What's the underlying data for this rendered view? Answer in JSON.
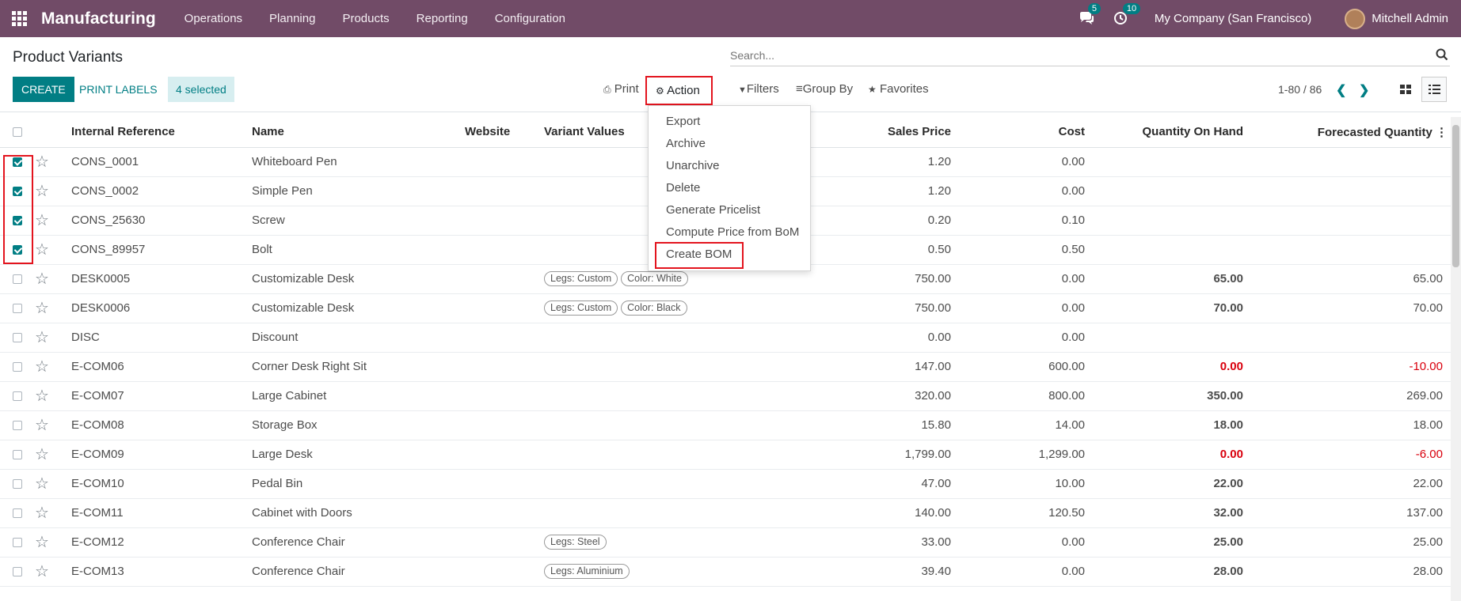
{
  "topbar": {
    "app_name": "Manufacturing",
    "menu": [
      "Operations",
      "Planning",
      "Products",
      "Reporting",
      "Configuration"
    ],
    "chat_count": "5",
    "activity_count": "10",
    "company": "My Company (San Francisco)",
    "user": "Mitchell Admin"
  },
  "control_panel": {
    "breadcrumb": "Product Variants",
    "search_placeholder": "Search...",
    "create_label": "CREATE",
    "print_labels_label": "PRINT LABELS",
    "selected_label": "4 selected",
    "print_label": "Print",
    "action_label": "Action",
    "filters_label": "Filters",
    "groupby_label": "Group By",
    "favorites_label": "Favorites",
    "pager": "1-80 / 86"
  },
  "action_menu": [
    "Export",
    "Archive",
    "Unarchive",
    "Delete",
    "Generate Pricelist",
    "Compute Price from BoM",
    "Create BOM"
  ],
  "columns": [
    "Internal Reference",
    "Name",
    "Website",
    "Variant Values",
    "Sales Price",
    "Cost",
    "Quantity On Hand",
    "Forecasted Quantity"
  ],
  "rows": [
    {
      "selected": true,
      "ref": "CONS_0001",
      "name": "Whiteboard Pen",
      "tags": [],
      "price": "1.20",
      "cost": "0.00",
      "qty": "",
      "forecast": ""
    },
    {
      "selected": true,
      "ref": "CONS_0002",
      "name": "Simple Pen",
      "tags": [],
      "price": "1.20",
      "cost": "0.00",
      "qty": "",
      "forecast": ""
    },
    {
      "selected": true,
      "ref": "CONS_25630",
      "name": "Screw",
      "tags": [],
      "price": "0.20",
      "cost": "0.10",
      "qty": "",
      "forecast": ""
    },
    {
      "selected": true,
      "ref": "CONS_89957",
      "name": "Bolt",
      "tags": [],
      "price": "0.50",
      "cost": "0.50",
      "qty": "",
      "forecast": ""
    },
    {
      "selected": false,
      "ref": "DESK0005",
      "name": "Customizable Desk",
      "tags": [
        "Legs: Custom",
        "Color: White"
      ],
      "price": "750.00",
      "cost": "0.00",
      "qty": "65.00",
      "forecast": "65.00"
    },
    {
      "selected": false,
      "ref": "DESK0006",
      "name": "Customizable Desk",
      "tags": [
        "Legs: Custom",
        "Color: Black"
      ],
      "price": "750.00",
      "cost": "0.00",
      "qty": "70.00",
      "forecast": "70.00"
    },
    {
      "selected": false,
      "ref": "DISC",
      "name": "Discount",
      "tags": [],
      "price": "0.00",
      "cost": "0.00",
      "qty": "",
      "forecast": ""
    },
    {
      "selected": false,
      "ref": "E-COM06",
      "name": "Corner Desk Right Sit",
      "tags": [],
      "price": "147.00",
      "cost": "600.00",
      "qty": "0.00",
      "forecast": "-10.00",
      "neg": true
    },
    {
      "selected": false,
      "ref": "E-COM07",
      "name": "Large Cabinet",
      "tags": [],
      "price": "320.00",
      "cost": "800.00",
      "qty": "350.00",
      "forecast": "269.00"
    },
    {
      "selected": false,
      "ref": "E-COM08",
      "name": "Storage Box",
      "tags": [],
      "price": "15.80",
      "cost": "14.00",
      "qty": "18.00",
      "forecast": "18.00"
    },
    {
      "selected": false,
      "ref": "E-COM09",
      "name": "Large Desk",
      "tags": [],
      "price": "1,799.00",
      "cost": "1,299.00",
      "qty": "0.00",
      "forecast": "-6.00",
      "neg": true
    },
    {
      "selected": false,
      "ref": "E-COM10",
      "name": "Pedal Bin",
      "tags": [],
      "price": "47.00",
      "cost": "10.00",
      "qty": "22.00",
      "forecast": "22.00"
    },
    {
      "selected": false,
      "ref": "E-COM11",
      "name": "Cabinet with Doors",
      "tags": [],
      "price": "140.00",
      "cost": "120.50",
      "qty": "32.00",
      "forecast": "137.00"
    },
    {
      "selected": false,
      "ref": "E-COM12",
      "name": "Conference Chair",
      "tags": [
        "Legs: Steel"
      ],
      "price": "33.00",
      "cost": "0.00",
      "qty": "25.00",
      "forecast": "25.00"
    },
    {
      "selected": false,
      "ref": "E-COM13",
      "name": "Conference Chair",
      "tags": [
        "Legs: Aluminium"
      ],
      "price": "39.40",
      "cost": "0.00",
      "qty": "28.00",
      "forecast": "28.00"
    }
  ],
  "colors": {
    "brand": "#714b67",
    "accent": "#017e84",
    "negative": "#d9000d",
    "highlight": "#e3141e"
  }
}
